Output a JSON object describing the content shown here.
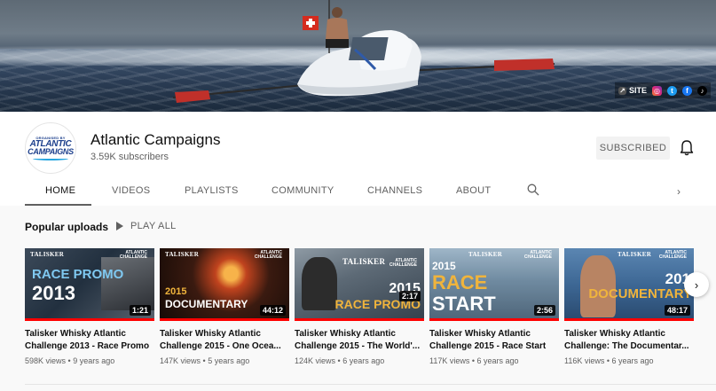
{
  "banner": {
    "links": {
      "site_label": "SITE",
      "icons": [
        "link-icon",
        "instagram-icon",
        "twitter-icon",
        "facebook-icon",
        "tiktok-icon"
      ]
    }
  },
  "channel": {
    "name": "Atlantic Campaigns",
    "subscribers": "3.59K subscribers",
    "avatar": {
      "line1": "ORGANISED BY",
      "line2": "ATLANTIC",
      "line3": "CAMPAIGNS"
    },
    "subscribed_label": "SUBSCRIBED"
  },
  "tabs": [
    {
      "label": "HOME",
      "active": true
    },
    {
      "label": "VIDEOS"
    },
    {
      "label": "PLAYLISTS"
    },
    {
      "label": "COMMUNITY"
    },
    {
      "label": "CHANNELS"
    },
    {
      "label": "ABOUT"
    }
  ],
  "section": {
    "title": "Popular uploads",
    "play_all": "PLAY ALL"
  },
  "videos": [
    {
      "title_line1": "Talisker Whisky Atlantic",
      "title_line2": "Challenge 2013 - Race Promo",
      "views": "598K views",
      "age": "9 years ago",
      "duration": "1:21",
      "thumb_text1": "RACE PROMO",
      "thumb_text2": "2013",
      "thumb_brand": "TALISKER",
      "thumb_brand2": "ATLANTIC CHALLENGE"
    },
    {
      "title_line1": "Talisker Whisky Atlantic",
      "title_line2": "Challenge 2015 - One Ocea...",
      "views": "147K views",
      "age": "5 years ago",
      "duration": "44:12",
      "thumb_text1": "2015",
      "thumb_text2": "DOCUMENTARY",
      "thumb_brand": "TALISKER",
      "thumb_brand2": "ATLANTIC CHALLENGE"
    },
    {
      "title_line1": "Talisker Whisky Atlantic",
      "title_line2": "Challenge 2015 - The World'...",
      "views": "124K views",
      "age": "6 years ago",
      "duration": "2:17",
      "thumb_text1": "2015",
      "thumb_text2": "RACE PROMO",
      "thumb_brand": "TALISKER",
      "thumb_brand2": "ATLANTIC CHALLENGE"
    },
    {
      "title_line1": "Talisker Whisky Atlantic",
      "title_line2": "Challenge 2015 - Race Start",
      "views": "117K views",
      "age": "6 years ago",
      "duration": "2:56",
      "thumb_text1": "2015",
      "thumb_text2": "RACE",
      "thumb_text3": "START",
      "thumb_brand": "TALISKER",
      "thumb_brand2": "ATLANTIC CHALLENGE"
    },
    {
      "title_line1": "Talisker Whisky Atlantic",
      "title_line2": "Challenge: The Documentar...",
      "views": "116K views",
      "age": "6 years ago",
      "duration": "48:17",
      "thumb_text1": "201",
      "thumb_text2": "DOCUMENTARY",
      "thumb_brand": "TALISKER",
      "thumb_brand2": "ATLANTIC CHALLENGE"
    }
  ],
  "colors": {
    "progress": "#ff0000",
    "avatar_blue": "#1c3f8c",
    "avatar_accent": "#27a6e0"
  }
}
